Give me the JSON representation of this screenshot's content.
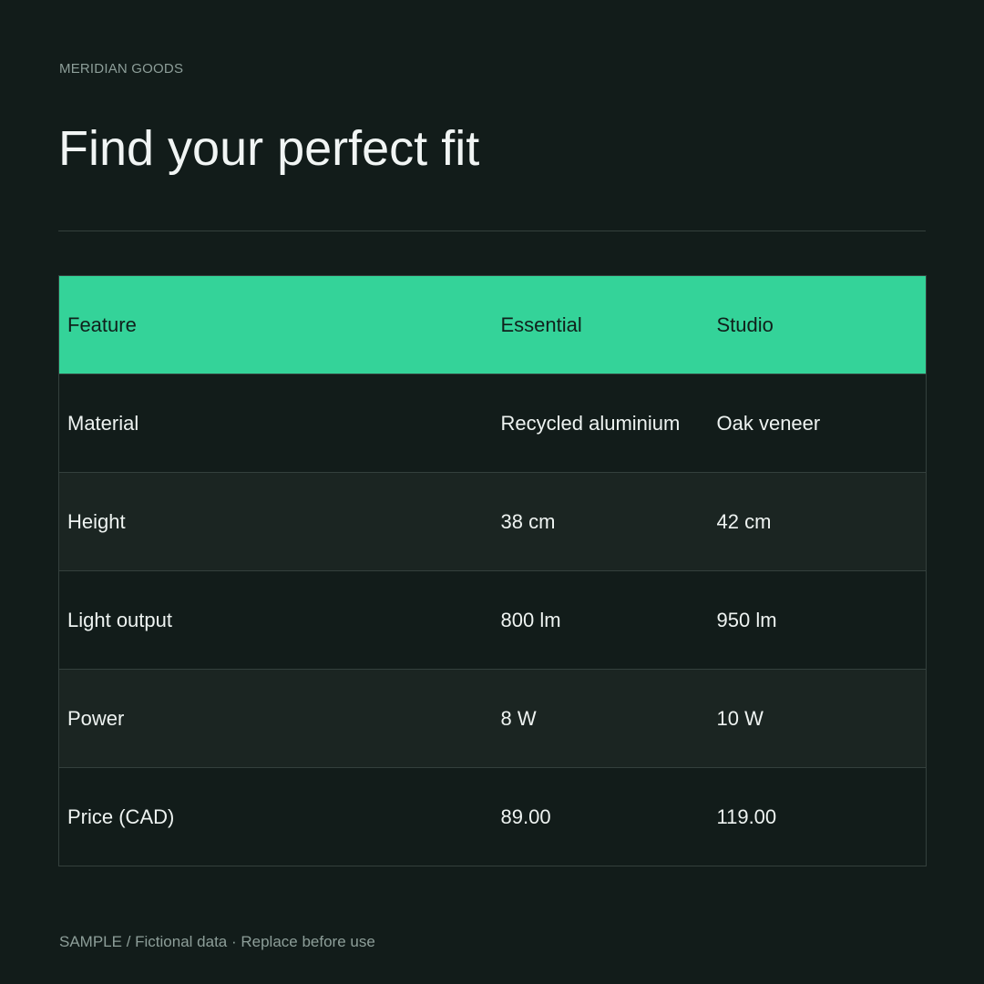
{
  "brand": "MERIDIAN GOODS",
  "title": "Find your perfect fit",
  "table": {
    "headers": [
      "Feature",
      "Essential",
      "Studio"
    ],
    "rows": [
      [
        "Material",
        "Recycled aluminium",
        "Oak veneer"
      ],
      [
        "Height",
        "38 cm",
        "42 cm"
      ],
      [
        "Light output",
        "800 lm",
        "950 lm"
      ],
      [
        "Power",
        "8 W",
        "10 W"
      ],
      [
        "Price (CAD)",
        "89.00",
        "119.00"
      ]
    ]
  },
  "footer": "SAMPLE / Fictional data · Replace before use",
  "colors": {
    "background": "#121c1a",
    "accent": "#34d399",
    "row_alt": "#1b2522"
  }
}
